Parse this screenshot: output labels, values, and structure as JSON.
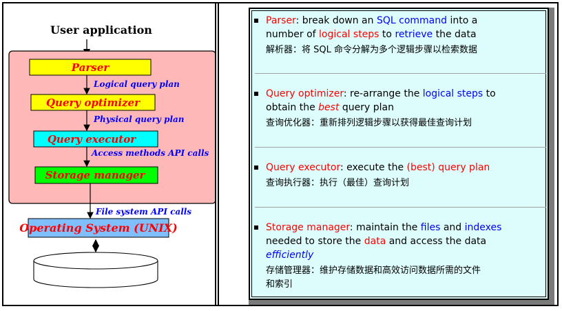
{
  "diagram": {
    "user_application": "User application",
    "parser": "Parser",
    "logical_query_plan": "Logical query plan",
    "query_optimizer": "Query optimizer",
    "physical_query_plan": "Physical query plan",
    "query_executor": "Query executor",
    "access_methods": "Access methods API calls",
    "storage_manager": "Storage manager",
    "file_system_calls": "File system API calls",
    "operating_system": "Operating System (UNIX)"
  },
  "bullets": {
    "parser": {
      "term": "Parser",
      "t1": ": break down an ",
      "sql_command": "SQL command",
      "t2": " into a",
      "t3": "number of ",
      "logical_steps": "logical steps",
      "t4": " to ",
      "retrieve": "retrieve",
      "t5": " the data",
      "cn": "解析器：将 SQL 命令分解为多个逻辑步骤以检索数据"
    },
    "optimizer": {
      "term": "Query optimizer",
      "t1": ": re-arrange the ",
      "logical_steps": "logical steps",
      "t2": " to",
      "t3": "obtain the ",
      "best": "best",
      "t4": " query plan",
      "cn": "查询优化器：重新排列逻辑步骤以获得最佳查询计划"
    },
    "executor": {
      "term": "Query executor",
      "t1": ": execute the ",
      "best_plan": "(best) query plan",
      "cn": "查询执行器：执行（最佳）查询计划"
    },
    "storage": {
      "term": "Storage manager",
      "t1": ": maintain the ",
      "files": "files",
      "t2": " and ",
      "indexes": "indexes",
      "t3": "needed to store the ",
      "data": "data",
      "t4": " and access the data",
      "efficiently": "efficiently",
      "cn1": "存储管理器：维护存储数据和高效访问数据所需的文件",
      "cn2": "和索引"
    }
  },
  "colors": {
    "panel_pink": "#ffb8b8",
    "parser_yellow": "#ffff00",
    "executor_cyan": "#00ffff",
    "storage_green": "#00ff00",
    "os_blue": "#7fbfff",
    "slide_bg": "#ddfcfc",
    "term_red": "#ff0000",
    "keyword_blue": "#0000ff"
  }
}
